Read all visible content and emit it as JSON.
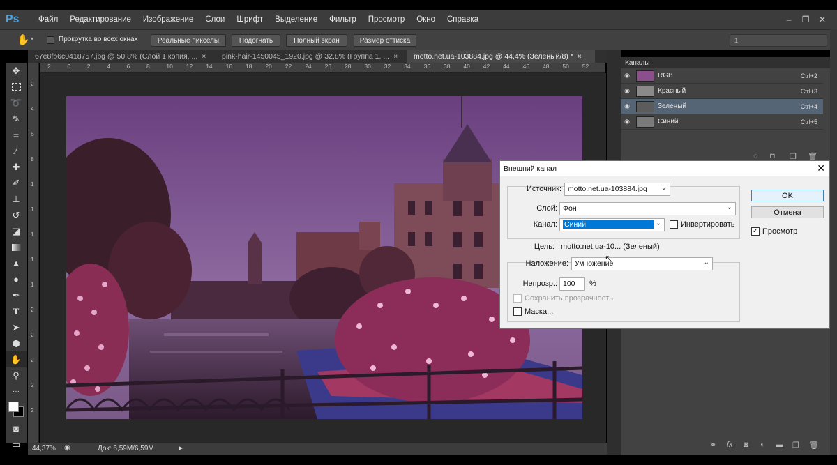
{
  "app": {
    "logo": "Ps"
  },
  "menu": [
    "Файл",
    "Редактирование",
    "Изображение",
    "Слои",
    "Шрифт",
    "Выделение",
    "Фильтр",
    "Просмотр",
    "Окно",
    "Справка"
  ],
  "window_controls": {
    "minimize": "–",
    "restore": "❐",
    "close": "✕"
  },
  "options_bar": {
    "scroll_all_label": "Прокрутка во всех окнах",
    "buttons": [
      "Реальные пикселы",
      "Подогнать",
      "Полный экран",
      "Размер оттиска"
    ],
    "workspace_field": "1"
  },
  "tabs": [
    {
      "label": "67e8fb6c0418757.jpg @ 50,8% (Слой 1 копия, ...",
      "close": "×"
    },
    {
      "label": "pink-hair-1450045_1920.jpg @ 32,8% (Группа 1, ...",
      "close": "×"
    },
    {
      "label": "motto.net.ua-103884.jpg @ 44,4% (Зеленый/8) *",
      "close": "×"
    }
  ],
  "ruler_ticks": [
    "2",
    "0",
    "2",
    "4",
    "6",
    "8",
    "10",
    "12",
    "14",
    "16",
    "18",
    "20",
    "22",
    "24",
    "26",
    "28",
    "30",
    "32",
    "34",
    "36",
    "38",
    "40",
    "42",
    "44",
    "46",
    "48",
    "50",
    "52"
  ],
  "ruler_left_ticks": [
    "2",
    "4",
    "6",
    "8",
    "1",
    "1",
    "1",
    "1",
    "1",
    "2",
    "2",
    "2",
    "2",
    "2"
  ],
  "status": {
    "zoom": "44,37%",
    "doc": "Док: 6,59M/6,59M"
  },
  "channels_panel": {
    "title": "Каналы",
    "rows": [
      {
        "name": "RGB",
        "shortcut": "Ctrl+2",
        "selected": false,
        "thumb": "#8a4f8c"
      },
      {
        "name": "Красный",
        "shortcut": "Ctrl+3",
        "selected": false,
        "thumb": "#8a8a8a"
      },
      {
        "name": "Зеленый",
        "shortcut": "Ctrl+4",
        "selected": true,
        "thumb": "#5c5c5c"
      },
      {
        "name": "Синий",
        "shortcut": "Ctrl+5",
        "selected": false,
        "thumb": "#7a7a7a"
      }
    ]
  },
  "dialog": {
    "title": "Внешний канал",
    "close": "✕",
    "source_label": "Источник:",
    "source_value": "motto.net.ua-103884.jpg",
    "layer_label": "Слой:",
    "layer_value": "Фон",
    "channel_label": "Канал:",
    "channel_value": "Синий",
    "invert_label": "Инвертировать",
    "target_label": "Цель:",
    "target_value": "motto.net.ua-10... (Зеленый)",
    "blending_label": "Наложение:",
    "blending_value": "Умножение",
    "opacity_label": "Непрозр.:",
    "opacity_value": "100",
    "opacity_unit": "%",
    "preserve_label": "Сохранить прозрачность",
    "mask_label": "Маска...",
    "ok": "OK",
    "cancel": "Отмена",
    "preview_label": "Просмотр",
    "preview_checked": "✓"
  }
}
